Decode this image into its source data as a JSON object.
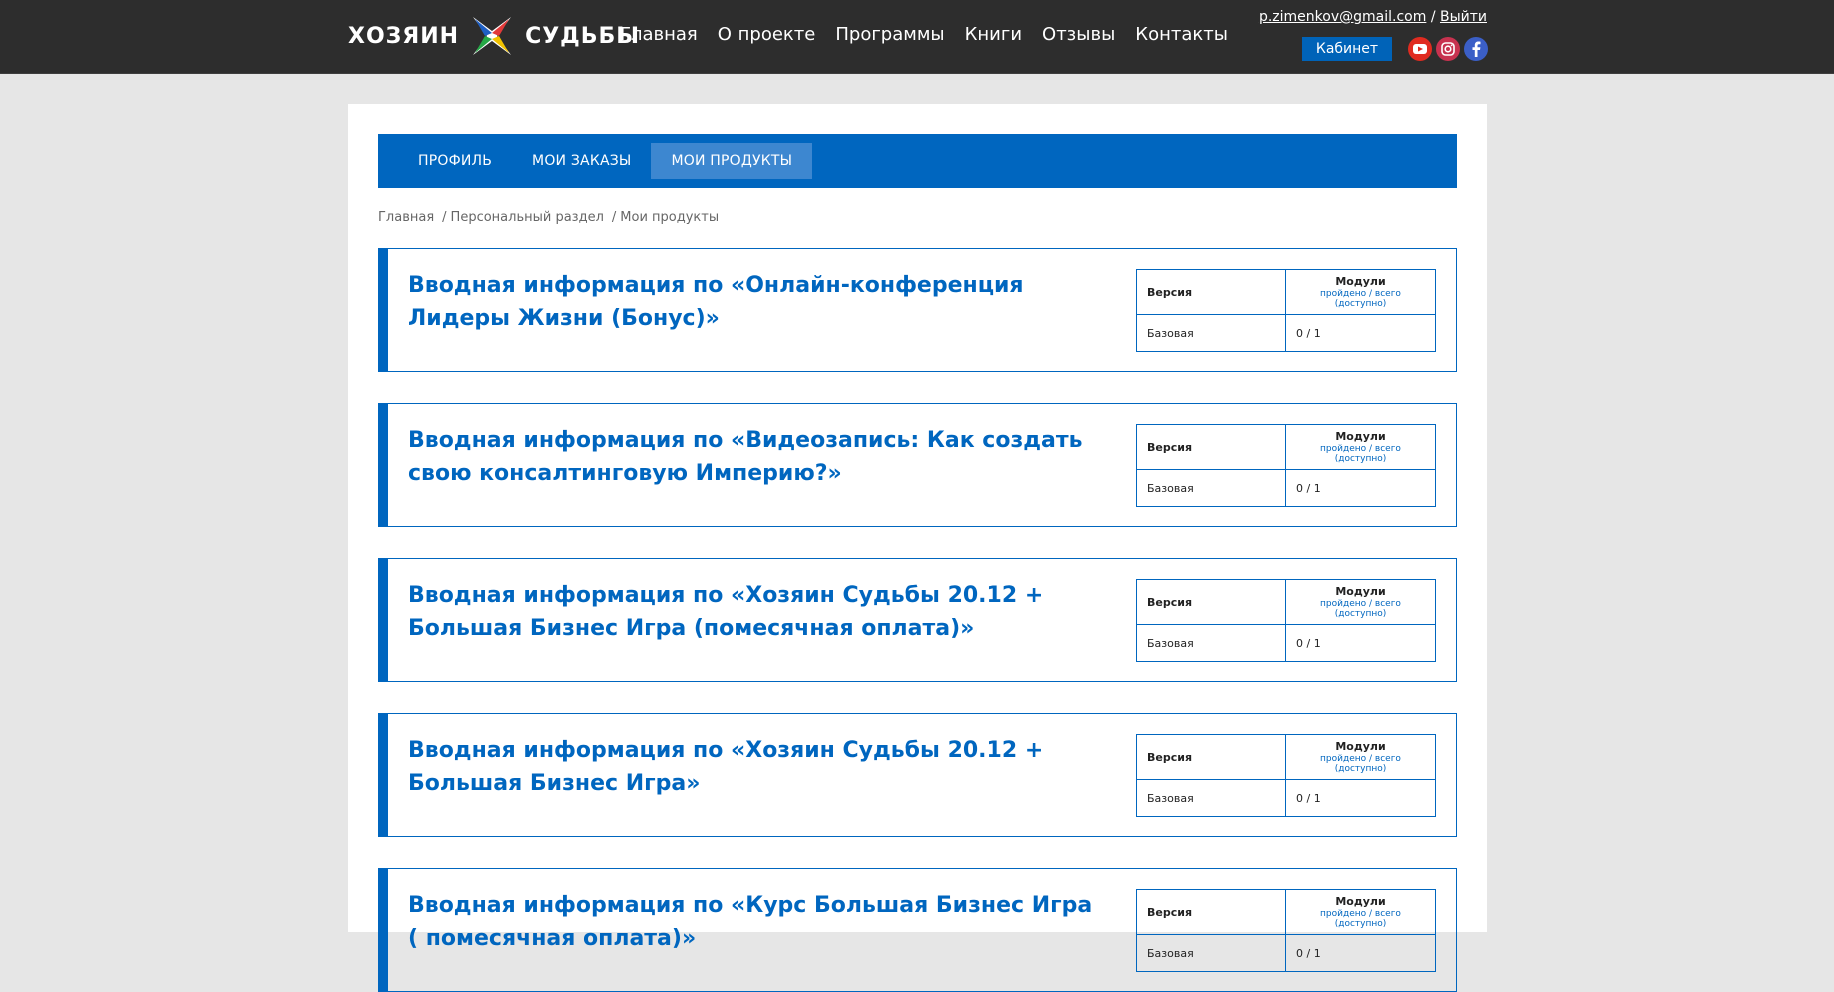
{
  "brand": {
    "left": "ХОЗЯИН",
    "right": "СУДЬБЫ"
  },
  "nav": [
    "Главная",
    "О проекте",
    "Программы",
    "Книги",
    "Отзывы",
    "Контакты"
  ],
  "user": {
    "email": "p.zimenkov@gmail.com",
    "separator": "/",
    "logout": "Выйти"
  },
  "cabinet_label": "Кабинет",
  "social_icons": [
    "youtube-icon",
    "instagram-icon",
    "facebook-icon"
  ],
  "colors": {
    "accent": "#0066bf",
    "header": "#2d2d2d"
  },
  "tabs": [
    {
      "label": "ПРОФИЛЬ",
      "active": false
    },
    {
      "label": "МОИ ЗАКАЗЫ",
      "active": false
    },
    {
      "label": "МОИ ПРОДУКТЫ",
      "active": true
    }
  ],
  "breadcrumb": [
    "Главная",
    "Персональный раздел",
    "Мои продукты"
  ],
  "table_headers": {
    "version": "Версия",
    "modules": "Модули",
    "modules_sub": "пройдено / всего (доступно)"
  },
  "products": [
    {
      "title": "Вводная информация по «Онлайн-конференция Лидеры Жизни (Бонус)»",
      "version": "Базовая",
      "modules": "0 / 1"
    },
    {
      "title": "Вводная информация по «Видеозапись: Как создать свою консалтинговую Империю?»",
      "version": "Базовая",
      "modules": "0 / 1"
    },
    {
      "title": "Вводная информация по «Хозяин Судьбы 20.12 + Большая Бизнес Игра (помесячная оплата)»",
      "version": "Базовая",
      "modules": "0 / 1"
    },
    {
      "title": "Вводная информация по «Хозяин Судьбы 20.12 + Большая Бизнес Игра»",
      "version": "Базовая",
      "modules": "0 / 1"
    },
    {
      "title": "Вводная информация по «Курс Большая Бизнес Игра ( помесячная оплата)»",
      "version": "Базовая",
      "modules": "0 / 1"
    }
  ]
}
